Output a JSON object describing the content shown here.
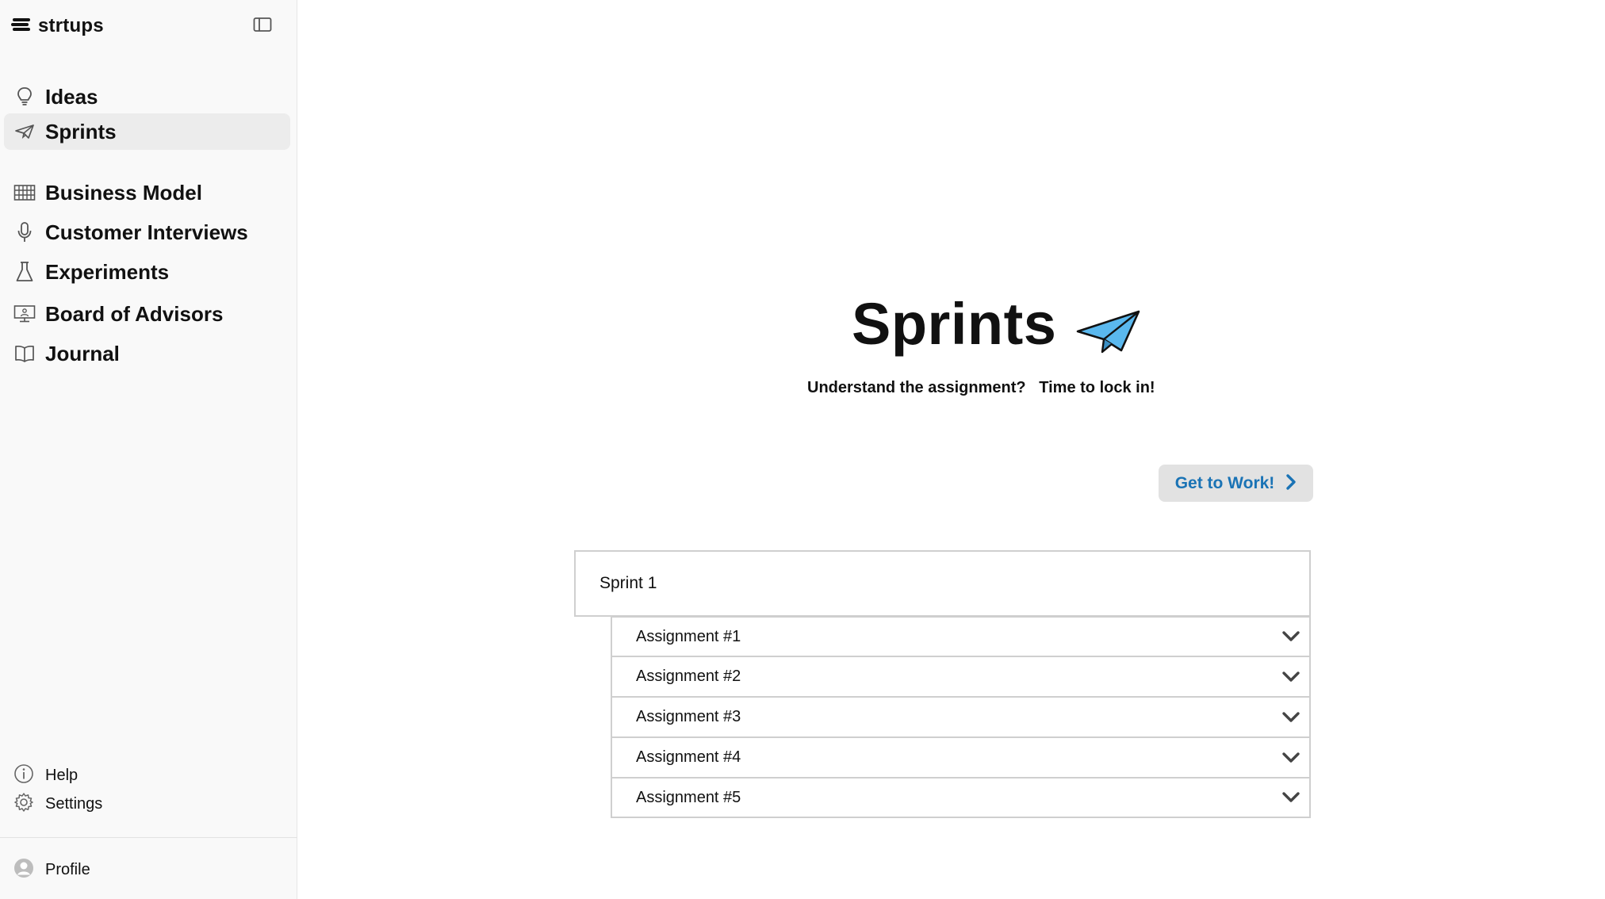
{
  "app": {
    "brand": "strtups"
  },
  "sidebar": {
    "top_items": [
      {
        "label": "Ideas",
        "icon": "lightbulb-icon"
      },
      {
        "label": "Sprints",
        "icon": "paper-plane-icon",
        "active": true
      }
    ],
    "items": [
      {
        "label": "Business Model",
        "icon": "grid-table-icon"
      },
      {
        "label": "Customer Interviews",
        "icon": "microphone-icon"
      },
      {
        "label": "Experiments",
        "icon": "flask-icon"
      },
      {
        "label": "Board of Advisors",
        "icon": "monitor-presentation-icon"
      },
      {
        "label": "Journal",
        "icon": "book-icon"
      }
    ],
    "help": "Help",
    "settings": "Settings",
    "profile": "Profile"
  },
  "main": {
    "title": "Sprints",
    "subtitle": "Understand the assignment?   Time to lock in!",
    "work_button": "Get to Work!",
    "sprint": "Sprint 1",
    "assignments": [
      "Assignment #1",
      "Assignment #2",
      "Assignment #3",
      "Assignment #4",
      "Assignment #5"
    ]
  },
  "colors": {
    "accent": "#1a73b5",
    "sidebar_bg": "#f9f9f9",
    "active_bg": "#ececec",
    "plane": "#5ab8ee"
  }
}
